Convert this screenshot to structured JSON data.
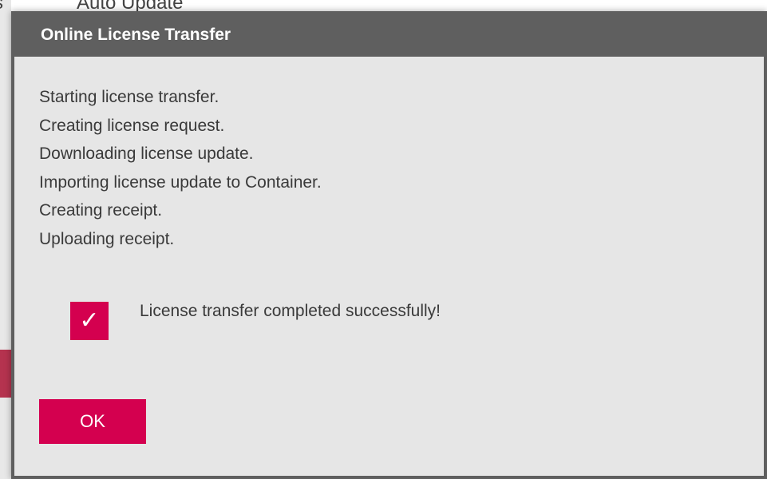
{
  "background": {
    "tab_left": "s",
    "tab_right": "Auto Update"
  },
  "dialog": {
    "title": "Online License Transfer",
    "log_lines": [
      "Starting license transfer.",
      "Creating license request.",
      "Downloading license update.",
      "Importing license update to Container.",
      "Creating receipt.",
      "Uploading receipt."
    ],
    "success_message": "License transfer completed successfully!",
    "success_icon": "checkmark-icon",
    "ok_label": "OK"
  },
  "colors": {
    "accent": "#d4004f",
    "header": "#5f5f5f",
    "dialog_bg": "#e6e6e6",
    "text": "#3a3a3a"
  }
}
